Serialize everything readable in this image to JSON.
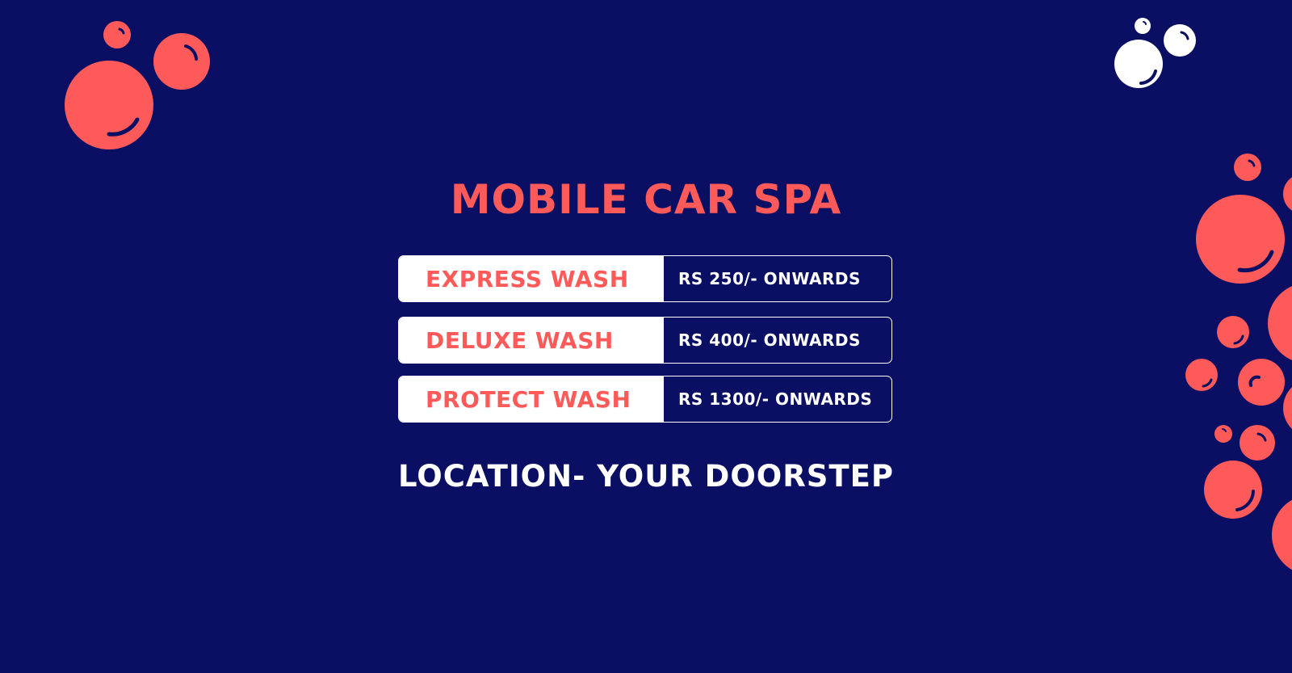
{
  "colors": {
    "background": "#0a0f63",
    "accent": "#fe5a5a",
    "white": "#ffffff"
  },
  "title": "MOBILE CAR SPA",
  "services": [
    {
      "name": "EXPRESS WASH",
      "price": "RS 250/- ONWARDS"
    },
    {
      "name": "DELUXE WASH",
      "price": "RS 400/- ONWARDS"
    },
    {
      "name": "PROTECT WASH",
      "price": "RS 1300/- ONWARDS"
    }
  ],
  "location": "LOCATION- YOUR DOORSTEP",
  "decorations": {
    "icon": "bubble-icon"
  }
}
